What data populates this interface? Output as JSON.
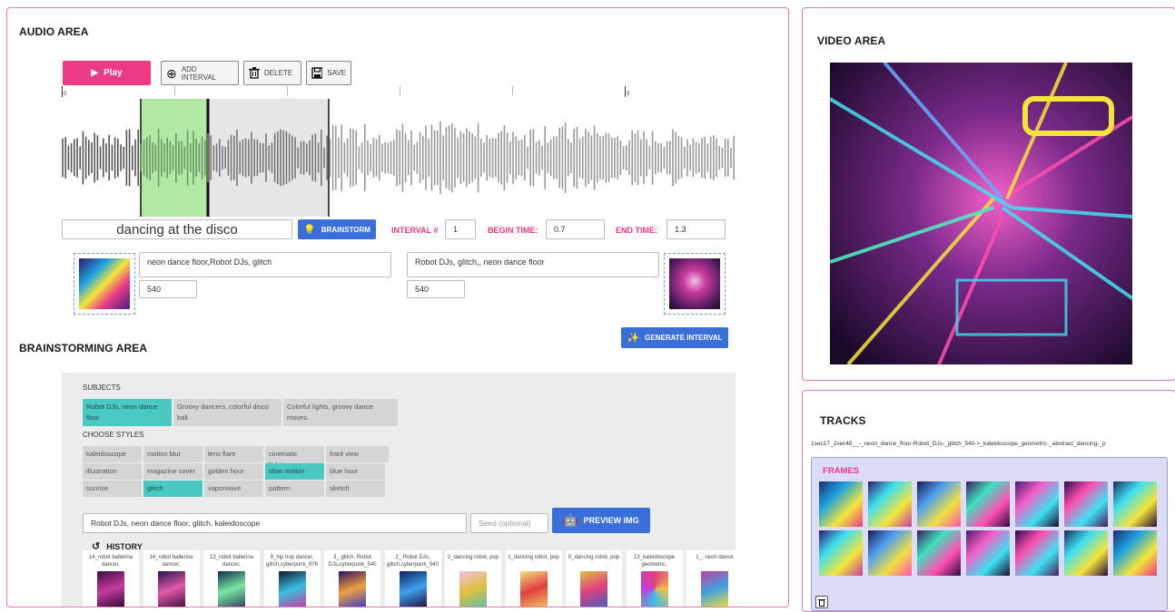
{
  "audio_area": {
    "title": "AUDIO AREA",
    "toolbar": {
      "play_label": "Play",
      "add_interval_label": "ADD INTERVAL",
      "delete_label": "DELETE",
      "save_label": "SAVE"
    },
    "timeline": {
      "start_label": "0",
      "mark_label": "5"
    },
    "prompt_input": "dancing at the disco",
    "brainstorm_button": "BRAINSTORM",
    "interval_label": "INTERVAL #",
    "interval_value": "1",
    "begin_time_label": "BEGIN TIME:",
    "begin_time_value": "0.7",
    "end_time_label": "END TIME:",
    "end_time_value": "1.3",
    "start_prompt": "neon dance floor,Robot DJs, glitch",
    "start_size": "540",
    "end_prompt": "Robot DJs, glitch,, neon dance floor",
    "end_size": "540",
    "generate_interval_button": "GENERATE INTERVAL"
  },
  "brainstorming_area": {
    "title": "BRAINSTORMING AREA",
    "subjects_label": "SUBJECTS",
    "subjects": [
      {
        "label": "Robot DJs, neon dance floor",
        "selected": true
      },
      {
        "label": "Groovy dancers, colorful disco ball.",
        "selected": false
      },
      {
        "label": "Colorful lights, groovy dance moves.",
        "selected": false
      }
    ],
    "styles_label": "CHOOSE STYLES",
    "styles": [
      {
        "label": "kaleidoscope",
        "selected": false
      },
      {
        "label": "motion blur",
        "selected": false
      },
      {
        "label": "lens flare",
        "selected": false
      },
      {
        "label": "cinematic lighting",
        "selected": false
      },
      {
        "label": "front view",
        "selected": false
      },
      {
        "label": "illustration",
        "selected": false
      },
      {
        "label": "magazine cover",
        "selected": false
      },
      {
        "label": "golden hour",
        "selected": false
      },
      {
        "label": "slow motion",
        "selected": true
      },
      {
        "label": "blue hour",
        "selected": false
      },
      {
        "label": "sunrise",
        "selected": false
      },
      {
        "label": "glitch",
        "selected": true
      },
      {
        "label": "vaporwave",
        "selected": false
      },
      {
        "label": "pattern",
        "selected": false
      },
      {
        "label": "sketch",
        "selected": false
      }
    ],
    "prompt_value": "Robot DJs, neon dance floor, glitch, kaleidoscope",
    "seed_placeholder": "Seed (optional)",
    "preview_button": "PREVIEW IMG",
    "history_label": "HISTORY",
    "history": [
      "14_robot ballerina dancer,",
      "14_robot ballerina dancer,",
      "13_robot ballerina dancer,",
      "9_hip hop dancer, glitch,cyberpunk_976",
      "3_ glitch, Robot DJs,cyberpunk_540",
      "2_ Robot DJs, glitch,cyberpunk_540",
      "2_dancing robot, pop",
      "1_dancing robot, pop",
      "0_dancing robot, pop",
      "13_kaleidoscope geometric,",
      "1_, neon dance"
    ]
  },
  "video_area": {
    "title": "VIDEO AREA"
  },
  "tracks": {
    "title": "TRACKS",
    "track_name": "1sec17_2sec48__-_neon_dance_floor-Robot_DJs-_glitch_540->_kaleidoscope_geometric-_abstract_dancing-_p",
    "frames_label": "FRAMES",
    "frame_count": 14
  },
  "colors": {
    "accent_pink": "#ec3a86",
    "accent_blue": "#3a6fd9",
    "selected_teal": "#49c9c2",
    "interval_green": "#b2e8a6"
  }
}
